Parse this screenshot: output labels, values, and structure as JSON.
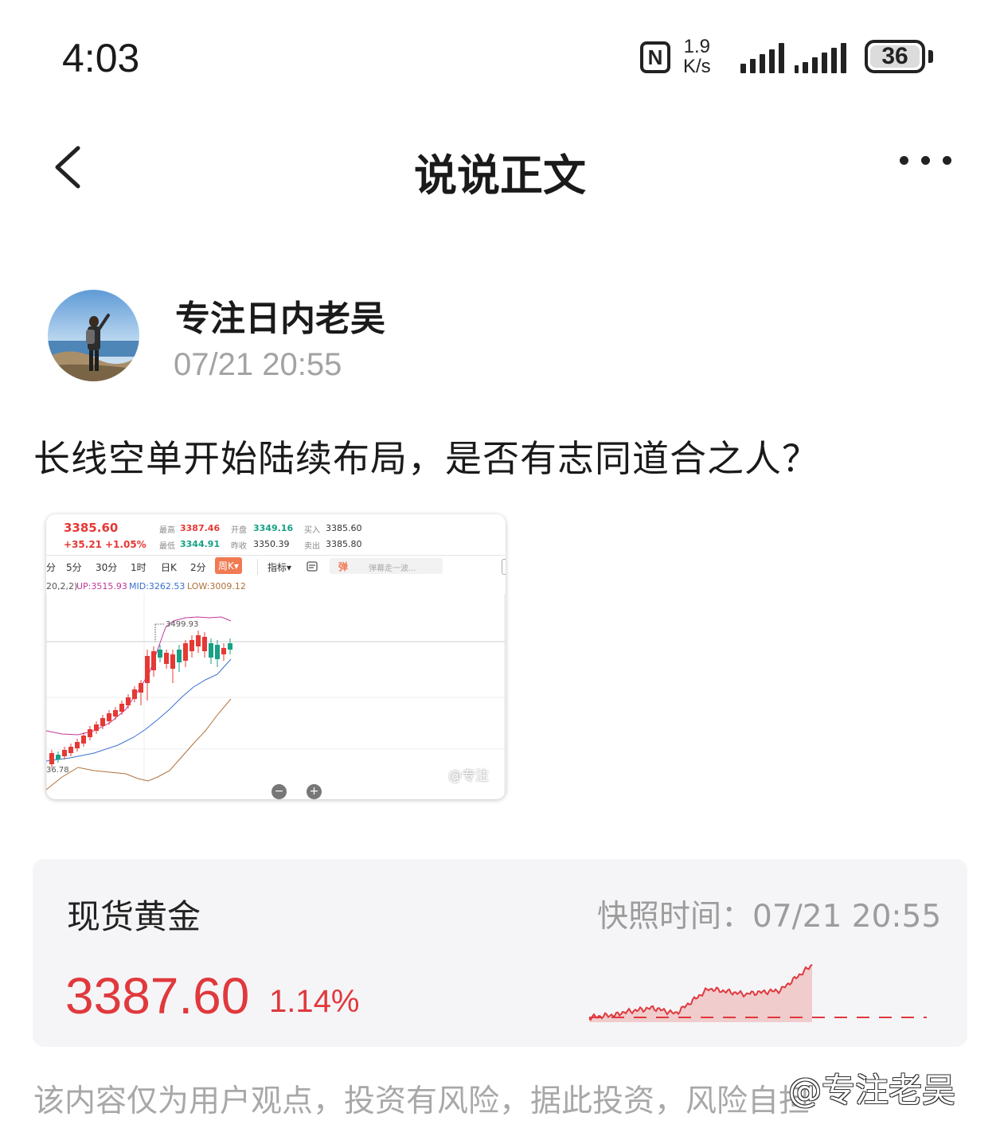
{
  "status_bar": {
    "time": "4:03",
    "nfc": "N",
    "speed_value": "1.9",
    "speed_unit": "K/s",
    "battery": "36"
  },
  "header": {
    "title": "说说正文"
  },
  "post": {
    "author": "专注日内老吴",
    "time": "07/21 20:55",
    "text": "长线空单开始陆续布局，是否有志同道合之人？"
  },
  "attached_screenshot": {
    "price": "3385.60",
    "change": "+35.21",
    "change_pct": "+1.05%",
    "high_label": "最高",
    "high": "3387.46",
    "low_label": "最低",
    "low": "3344.91",
    "open_label": "开盘",
    "open": "3349.16",
    "prev_close_label": "昨收",
    "prev_close": "3350.39",
    "buy_label": "买入",
    "buy": "3385.60",
    "sell_label": "卖出",
    "sell": "3385.80",
    "tabs": [
      "分",
      "5分",
      "30分",
      "1时",
      "日K",
      "2分",
      "周K▾"
    ],
    "indicator_label": "指标▾",
    "danmu_label": "弹",
    "danmu_placeholder": "弹幕走一波...",
    "boll_params": "20,2,2)",
    "boll_up": "UP:3515.93",
    "boll_mid": "MID:3262.53",
    "boll_low": "LOW:3009.12",
    "peak_label": "3499.93",
    "bottom_label": "36.78",
    "watermark": "@专注",
    "zoom_out": "−",
    "zoom_in": "+"
  },
  "gold_card": {
    "name": "现货黄金",
    "snapshot": "快照时间：07/21 20:55",
    "price": "3387.60",
    "change": "1.14%",
    "color_up": "#e0393d"
  },
  "footer": {
    "disclaimer": "该内容仅为用户观点，投资有风险，据此投资，风险自担",
    "watermark": "@专注老吴"
  }
}
